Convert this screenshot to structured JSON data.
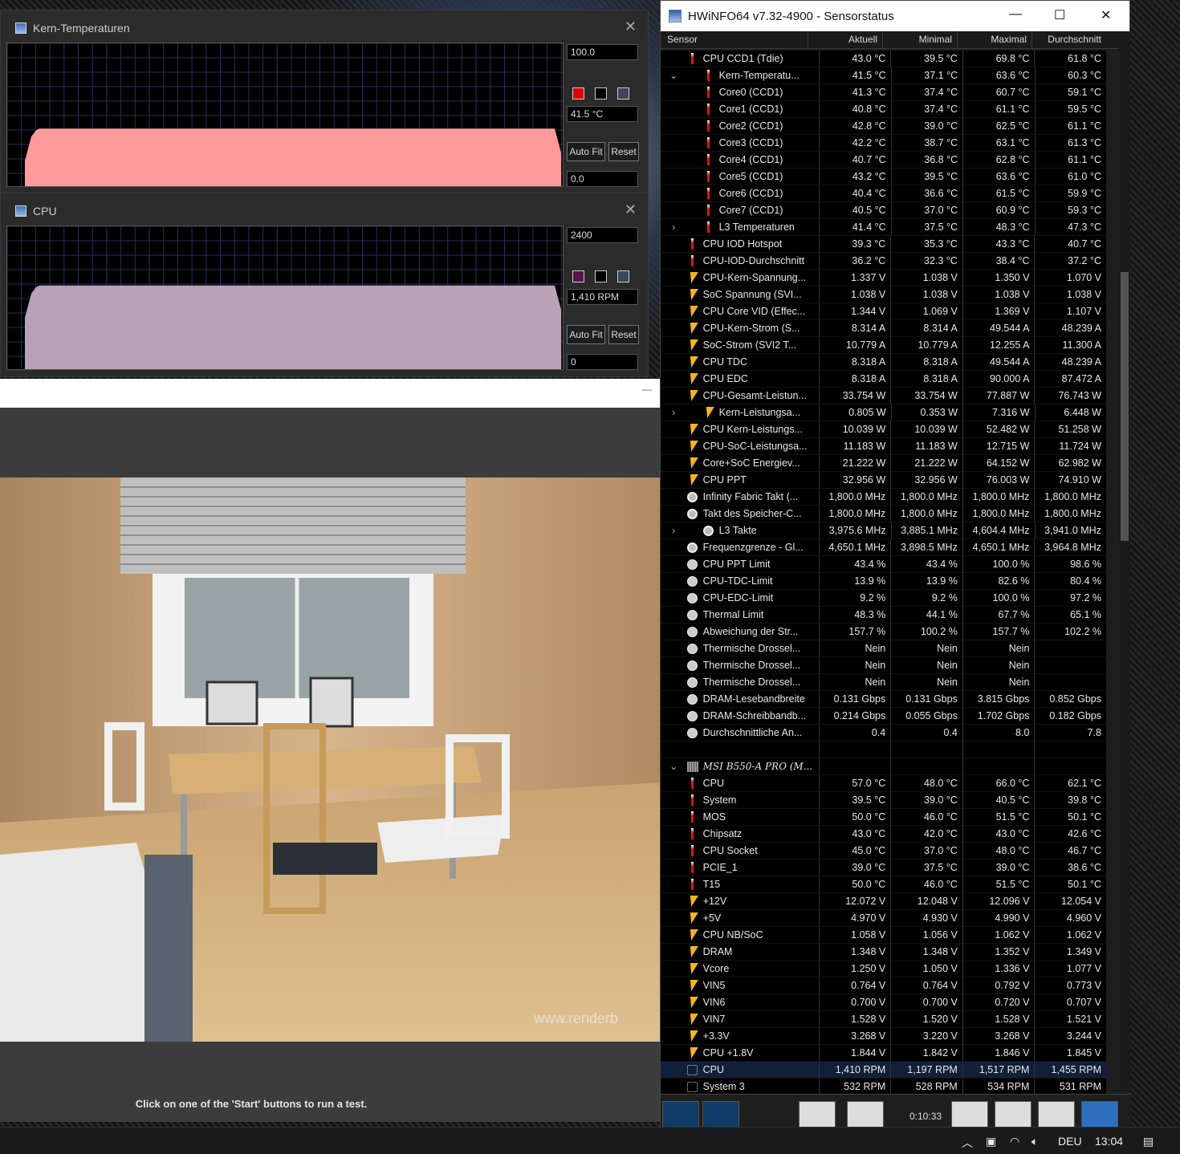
{
  "graphs": [
    {
      "title": "Kern-Temperaturen",
      "max_label": "100.0",
      "current_label": "41.5 °C",
      "min_label": "0.0",
      "auto_fit": "Auto Fit",
      "reset": "Reset",
      "color": "#ff9b9b",
      "swatch": "#e00000",
      "level": 0.41
    },
    {
      "title": "CPU",
      "max_label": "2400",
      "current_label": "1,410 RPM",
      "min_label": "0",
      "auto_fit": "Auto Fit",
      "reset": "Reset",
      "color": "#b9a2b8",
      "swatch": "#5a1350",
      "level": 0.59
    }
  ],
  "app": {
    "hint": "Click on one of the 'Start' buttons to run a test.",
    "watermark": "www.renderb"
  },
  "hwinfo": {
    "title": "HWiNFO64 v7.32-4900 - Sensorstatus",
    "columns": [
      "Sensor",
      "Aktuell",
      "Minimal",
      "Maximal",
      "Durchschnitt"
    ],
    "rows": [
      {
        "ic": "t",
        "exp": "",
        "ind": 0,
        "name": "CPU CCD1 (Tdie)",
        "a": "43.0 °C",
        "mn": "39.5 °C",
        "mx": "69.8 °C",
        "av": "61.8 °C"
      },
      {
        "ic": "t",
        "exp": "⌄",
        "ind": 20,
        "name": "Kern-Temperatu...",
        "a": "41.5 °C",
        "mn": "37.1 °C",
        "mx": "63.6 °C",
        "av": "60.3 °C"
      },
      {
        "ic": "t",
        "exp": "",
        "ind": 20,
        "name": "Core0 (CCD1)",
        "a": "41.3 °C",
        "mn": "37.4 °C",
        "mx": "60.7 °C",
        "av": "59.1 °C"
      },
      {
        "ic": "t",
        "exp": "",
        "ind": 20,
        "name": "Core1 (CCD1)",
        "a": "40.8 °C",
        "mn": "37.4 °C",
        "mx": "61.1 °C",
        "av": "59.5 °C"
      },
      {
        "ic": "t",
        "exp": "",
        "ind": 20,
        "name": "Core2 (CCD1)",
        "a": "42.8 °C",
        "mn": "39.0 °C",
        "mx": "62.5 °C",
        "av": "61.1 °C"
      },
      {
        "ic": "t",
        "exp": "",
        "ind": 20,
        "name": "Core3 (CCD1)",
        "a": "42.2 °C",
        "mn": "38.7 °C",
        "mx": "63.1 °C",
        "av": "61.3 °C"
      },
      {
        "ic": "t",
        "exp": "",
        "ind": 20,
        "name": "Core4 (CCD1)",
        "a": "40.7 °C",
        "mn": "36.8 °C",
        "mx": "62.8 °C",
        "av": "61.1 °C"
      },
      {
        "ic": "t",
        "exp": "",
        "ind": 20,
        "name": "Core5 (CCD1)",
        "a": "43.2 °C",
        "mn": "39.5 °C",
        "mx": "63.6 °C",
        "av": "61.0 °C"
      },
      {
        "ic": "t",
        "exp": "",
        "ind": 20,
        "name": "Core6 (CCD1)",
        "a": "40.4 °C",
        "mn": "36.6 °C",
        "mx": "61.5 °C",
        "av": "59.9 °C"
      },
      {
        "ic": "t",
        "exp": "",
        "ind": 20,
        "name": "Core7 (CCD1)",
        "a": "40.5 °C",
        "mn": "37.0 °C",
        "mx": "60.9 °C",
        "av": "59.3 °C"
      },
      {
        "ic": "t",
        "exp": "›",
        "ind": 20,
        "name": "L3 Temperaturen",
        "a": "41.4 °C",
        "mn": "37.5 °C",
        "mx": "48.3 °C",
        "av": "47.3 °C"
      },
      {
        "ic": "t",
        "exp": "",
        "ind": 0,
        "name": "CPU IOD Hotspot",
        "a": "39.3 °C",
        "mn": "35.3 °C",
        "mx": "43.3 °C",
        "av": "40.7 °C"
      },
      {
        "ic": "t",
        "exp": "",
        "ind": 0,
        "name": "CPU-IOD-Durchschnitt",
        "a": "36.2 °C",
        "mn": "32.3 °C",
        "mx": "38.4 °C",
        "av": "37.2 °C"
      },
      {
        "ic": "v",
        "exp": "",
        "ind": 0,
        "name": "CPU-Kern-Spannung...",
        "a": "1.337 V",
        "mn": "1.038 V",
        "mx": "1.350 V",
        "av": "1.070 V"
      },
      {
        "ic": "v",
        "exp": "",
        "ind": 0,
        "name": "SoC Spannung (SVI...",
        "a": "1.038 V",
        "mn": "1.038 V",
        "mx": "1.038 V",
        "av": "1.038 V"
      },
      {
        "ic": "v",
        "exp": "",
        "ind": 0,
        "name": "CPU Core VID (Effec...",
        "a": "1.344 V",
        "mn": "1.069 V",
        "mx": "1.369 V",
        "av": "1.107 V"
      },
      {
        "ic": "v",
        "exp": "",
        "ind": 0,
        "name": "CPU-Kern-Strom (S...",
        "a": "8.314 A",
        "mn": "8.314 A",
        "mx": "49.544 A",
        "av": "48.239 A"
      },
      {
        "ic": "v",
        "exp": "",
        "ind": 0,
        "name": "SoC-Strom (SVI2 T...",
        "a": "10.779 A",
        "mn": "10.779 A",
        "mx": "12.255 A",
        "av": "11.300 A"
      },
      {
        "ic": "v",
        "exp": "",
        "ind": 0,
        "name": "CPU TDC",
        "a": "8.318 A",
        "mn": "8.318 A",
        "mx": "49.544 A",
        "av": "48.239 A"
      },
      {
        "ic": "v",
        "exp": "",
        "ind": 0,
        "name": "CPU EDC",
        "a": "8.318 A",
        "mn": "8.318 A",
        "mx": "90.000 A",
        "av": "87.472 A"
      },
      {
        "ic": "v",
        "exp": "",
        "ind": 0,
        "name": "CPU-Gesamt-Leistun...",
        "a": "33.754 W",
        "mn": "33.754 W",
        "mx": "77.887 W",
        "av": "76.743 W"
      },
      {
        "ic": "v",
        "exp": "›",
        "ind": 20,
        "name": "Kern-Leistungsa...",
        "a": "0.805 W",
        "mn": "0.353 W",
        "mx": "7.316 W",
        "av": "6.448 W"
      },
      {
        "ic": "v",
        "exp": "",
        "ind": 0,
        "name": "CPU Kern-Leistungs...",
        "a": "10.039 W",
        "mn": "10.039 W",
        "mx": "52.482 W",
        "av": "51.258 W"
      },
      {
        "ic": "v",
        "exp": "",
        "ind": 0,
        "name": "CPU-SoC-Leistungsa...",
        "a": "11.183 W",
        "mn": "11.183 W",
        "mx": "12.715 W",
        "av": "11.724 W"
      },
      {
        "ic": "v",
        "exp": "",
        "ind": 0,
        "name": "Core+SoC Energiev...",
        "a": "21.222 W",
        "mn": "21.222 W",
        "mx": "64.152 W",
        "av": "62.982 W"
      },
      {
        "ic": "v",
        "exp": "",
        "ind": 0,
        "name": "CPU PPT",
        "a": "32.956 W",
        "mn": "32.956 W",
        "mx": "76.003 W",
        "av": "74.910 W"
      },
      {
        "ic": "f",
        "exp": "",
        "ind": 0,
        "name": "Infinity Fabric Takt (...",
        "a": "1,800.0 MHz",
        "mn": "1,800.0 MHz",
        "mx": "1,800.0 MHz",
        "av": "1,800.0 MHz"
      },
      {
        "ic": "f",
        "exp": "",
        "ind": 0,
        "name": "Takt des Speicher-C...",
        "a": "1,800.0 MHz",
        "mn": "1,800.0 MHz",
        "mx": "1,800.0 MHz",
        "av": "1,800.0 MHz"
      },
      {
        "ic": "f",
        "exp": "›",
        "ind": 20,
        "name": "L3 Takte",
        "a": "3,975.6 MHz",
        "mn": "3,885.1 MHz",
        "mx": "4,604.4 MHz",
        "av": "3,941.0 MHz"
      },
      {
        "ic": "f",
        "exp": "",
        "ind": 0,
        "name": "Frequenzgrenze - Gl...",
        "a": "4,650.1 MHz",
        "mn": "3,898.5 MHz",
        "mx": "4,650.1 MHz",
        "av": "3,964.8 MHz"
      },
      {
        "ic": "p",
        "exp": "",
        "ind": 0,
        "name": "CPU PPT Limit",
        "a": "43.4 %",
        "mn": "43.4 %",
        "mx": "100.0 %",
        "av": "98.6 %"
      },
      {
        "ic": "p",
        "exp": "",
        "ind": 0,
        "name": "CPU-TDC-Limit",
        "a": "13.9 %",
        "mn": "13.9 %",
        "mx": "82.6 %",
        "av": "80.4 %"
      },
      {
        "ic": "p",
        "exp": "",
        "ind": 0,
        "name": "CPU-EDC-Limit",
        "a": "9.2 %",
        "mn": "9.2 %",
        "mx": "100.0 %",
        "av": "97.2 %"
      },
      {
        "ic": "p",
        "exp": "",
        "ind": 0,
        "name": "Thermal Limit",
        "a": "48.3 %",
        "mn": "44.1 %",
        "mx": "67.7 %",
        "av": "65.1 %"
      },
      {
        "ic": "p",
        "exp": "",
        "ind": 0,
        "name": "Abweichung der Str...",
        "a": "157.7 %",
        "mn": "100.2 %",
        "mx": "157.7 %",
        "av": "102.2 %"
      },
      {
        "ic": "p",
        "exp": "",
        "ind": 0,
        "name": "Thermische Drossel...",
        "a": "Nein",
        "mn": "Nein",
        "mx": "Nein",
        "av": ""
      },
      {
        "ic": "p",
        "exp": "",
        "ind": 0,
        "name": "Thermische Drossel...",
        "a": "Nein",
        "mn": "Nein",
        "mx": "Nein",
        "av": ""
      },
      {
        "ic": "p",
        "exp": "",
        "ind": 0,
        "name": "Thermische Drossel...",
        "a": "Nein",
        "mn": "Nein",
        "mx": "Nein",
        "av": ""
      },
      {
        "ic": "p",
        "exp": "",
        "ind": 0,
        "name": "DRAM-Lesebandbreite",
        "a": "0.131 Gbps",
        "mn": "0.131 Gbps",
        "mx": "3.815 Gbps",
        "av": "0.852 Gbps"
      },
      {
        "ic": "p",
        "exp": "",
        "ind": 0,
        "name": "DRAM-Schreibbandb...",
        "a": "0.214 Gbps",
        "mn": "0.055 Gbps",
        "mx": "1.702 Gbps",
        "av": "0.182 Gbps"
      },
      {
        "ic": "p",
        "exp": "",
        "ind": 0,
        "name": "Durchschnittliche An...",
        "a": "0.4",
        "mn": "0.4",
        "mx": "8.0",
        "av": "7.8"
      },
      {
        "ic": "",
        "exp": "",
        "ind": 0,
        "name": "",
        "a": "",
        "mn": "",
        "mx": "",
        "av": "",
        "blank": true
      },
      {
        "ic": "b",
        "exp": "⌄",
        "ind": 0,
        "name": "MSI B550-A PRO (M...",
        "a": "",
        "mn": "",
        "mx": "",
        "av": "",
        "group": true
      },
      {
        "ic": "t",
        "exp": "",
        "ind": 0,
        "name": "CPU",
        "a": "57.0 °C",
        "mn": "48.0 °C",
        "mx": "66.0 °C",
        "av": "62.1 °C"
      },
      {
        "ic": "t",
        "exp": "",
        "ind": 0,
        "name": "System",
        "a": "39.5 °C",
        "mn": "39.0 °C",
        "mx": "40.5 °C",
        "av": "39.8 °C"
      },
      {
        "ic": "t",
        "exp": "",
        "ind": 0,
        "name": "MOS",
        "a": "50.0 °C",
        "mn": "46.0 °C",
        "mx": "51.5 °C",
        "av": "50.1 °C"
      },
      {
        "ic": "t",
        "exp": "",
        "ind": 0,
        "name": "Chipsatz",
        "a": "43.0 °C",
        "mn": "42.0 °C",
        "mx": "43.0 °C",
        "av": "42.6 °C"
      },
      {
        "ic": "t",
        "exp": "",
        "ind": 0,
        "name": "CPU Socket",
        "a": "45.0 °C",
        "mn": "37.0 °C",
        "mx": "48.0 °C",
        "av": "46.7 °C"
      },
      {
        "ic": "t",
        "exp": "",
        "ind": 0,
        "name": "PCIE_1",
        "a": "39.0 °C",
        "mn": "37.5 °C",
        "mx": "39.0 °C",
        "av": "38.6 °C"
      },
      {
        "ic": "t",
        "exp": "",
        "ind": 0,
        "name": "T15",
        "a": "50.0 °C",
        "mn": "46.0 °C",
        "mx": "51.5 °C",
        "av": "50.1 °C"
      },
      {
        "ic": "v",
        "exp": "",
        "ind": 0,
        "name": "+12V",
        "a": "12.072 V",
        "mn": "12.048 V",
        "mx": "12.096 V",
        "av": "12.054 V"
      },
      {
        "ic": "v",
        "exp": "",
        "ind": 0,
        "name": "+5V",
        "a": "4.970 V",
        "mn": "4.930 V",
        "mx": "4.990 V",
        "av": "4.960 V"
      },
      {
        "ic": "v",
        "exp": "",
        "ind": 0,
        "name": "CPU NB/SoC",
        "a": "1.058 V",
        "mn": "1.056 V",
        "mx": "1.062 V",
        "av": "1.062 V"
      },
      {
        "ic": "v",
        "exp": "",
        "ind": 0,
        "name": "DRAM",
        "a": "1.348 V",
        "mn": "1.348 V",
        "mx": "1.352 V",
        "av": "1.349 V"
      },
      {
        "ic": "v",
        "exp": "",
        "ind": 0,
        "name": "Vcore",
        "a": "1.250 V",
        "mn": "1.050 V",
        "mx": "1.336 V",
        "av": "1.077 V"
      },
      {
        "ic": "v",
        "exp": "",
        "ind": 0,
        "name": "VIN5",
        "a": "0.764 V",
        "mn": "0.764 V",
        "mx": "0.792 V",
        "av": "0.773 V"
      },
      {
        "ic": "v",
        "exp": "",
        "ind": 0,
        "name": "VIN6",
        "a": "0.700 V",
        "mn": "0.700 V",
        "mx": "0.720 V",
        "av": "0.707 V"
      },
      {
        "ic": "v",
        "exp": "",
        "ind": 0,
        "name": "VIN7",
        "a": "1.528 V",
        "mn": "1.520 V",
        "mx": "1.528 V",
        "av": "1.521 V"
      },
      {
        "ic": "v",
        "exp": "",
        "ind": 0,
        "name": "+3.3V",
        "a": "3.268 V",
        "mn": "3.220 V",
        "mx": "3.268 V",
        "av": "3.244 V"
      },
      {
        "ic": "v",
        "exp": "",
        "ind": 0,
        "name": "CPU +1.8V",
        "a": "1.844 V",
        "mn": "1.842 V",
        "mx": "1.846 V",
        "av": "1.845 V"
      },
      {
        "ic": "fan",
        "exp": "",
        "ind": 0,
        "name": "CPU",
        "a": "1,410 RPM",
        "mn": "1,197 RPM",
        "mx": "1,517 RPM",
        "av": "1,455 RPM",
        "sel": true
      },
      {
        "ic": "fan",
        "exp": "",
        "ind": 0,
        "name": "System 3",
        "a": "532 RPM",
        "mn": "528 RPM",
        "mx": "534 RPM",
        "av": "531 RPM"
      }
    ],
    "timer": "0:10:33"
  },
  "taskbar": {
    "lang": "DEU",
    "time": "13:04"
  }
}
